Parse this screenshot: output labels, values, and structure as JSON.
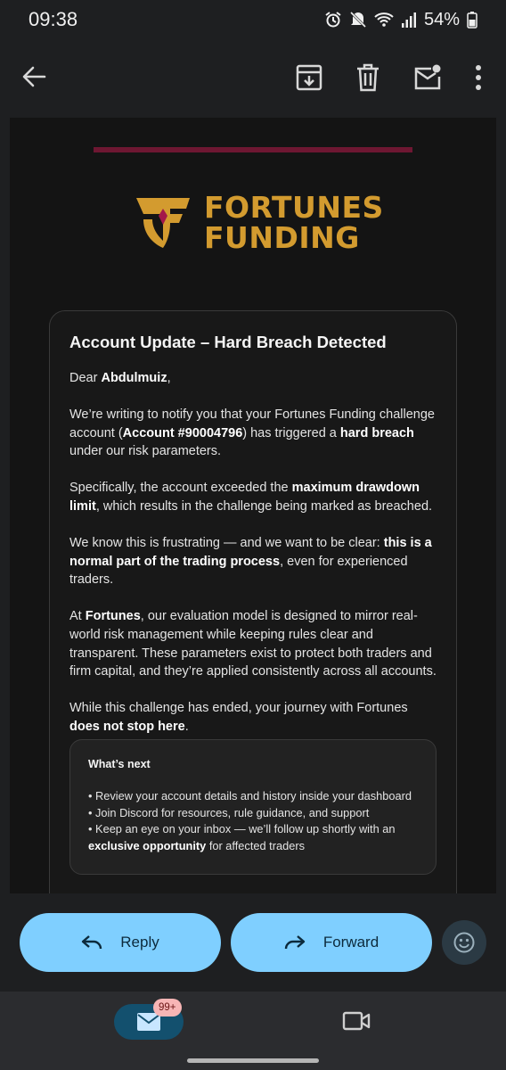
{
  "status_bar": {
    "time": "09:38",
    "battery": "54%"
  },
  "logo": {
    "line1": "FORTUNES",
    "line2": "FUNDING"
  },
  "email": {
    "title": "Account Update – Hard Breach Detected",
    "greeting_prefix": "Dear ",
    "greeting_name": "Abdulmuiz",
    "greeting_suffix": ",",
    "p1_a": "We’re writing to notify you that your Fortunes Funding challenge account (",
    "p1_b": "Account #90004796",
    "p1_c": ") has triggered a ",
    "p1_d": "hard breach",
    "p1_e": " under our risk parameters.",
    "p2_a": "Specifically, the account exceeded the ",
    "p2_b": "maximum drawdown limit",
    "p2_c": ", which results in the challenge being marked as breached.",
    "p3_a": "We know this is frustrating — and we want to be clear: ",
    "p3_b": "this is a normal part of the trading process",
    "p3_c": ", even for experienced traders.",
    "p4_a": "At ",
    "p4_b": "Fortunes",
    "p4_c": ", our evaluation model is designed to mirror real-world risk management while keeping rules clear and transparent. These parameters exist to protect both traders and firm capital, and they’re applied consistently across all accounts.",
    "p5_a": "While this challenge has ended, your journey with Fortunes ",
    "p5_b": "does not stop here",
    "p5_c": ".",
    "next": {
      "title": "What’s next",
      "item1": "• Review your account details and history inside your dashboard",
      "item2": "• Join Discord for resources, rule guidance, and support",
      "item3_a": "• Keep an eye on your inbox — we’ll follow up shortly with an ",
      "item3_b": "exclusive opportunity",
      "item3_c": " for affected traders"
    }
  },
  "actions": {
    "reply": "Reply",
    "forward": "Forward"
  },
  "nav": {
    "badge": "99+"
  },
  "colors": {
    "accent_button": "#7fcfff",
    "logo_gold": "#d39b2f",
    "rule": "#6e1732"
  }
}
